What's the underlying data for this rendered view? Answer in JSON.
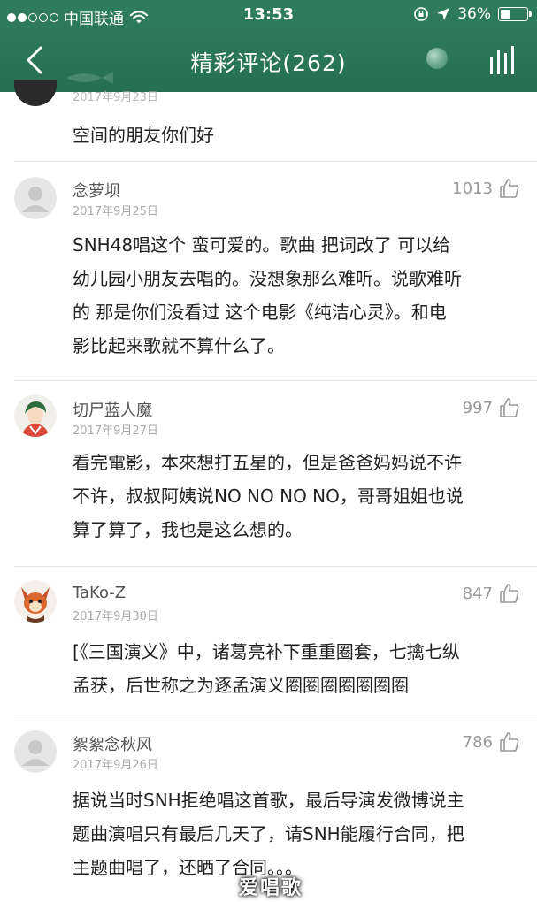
{
  "status_bar": {
    "carrier": "中国联通",
    "time": "13:53",
    "battery_percent": "36%",
    "battery_level": 0.36
  },
  "nav": {
    "title": "精彩评论(262)",
    "back_icon": "chevron-left-icon",
    "right_icon": "equalizer-bars-icon"
  },
  "partial_comment": {
    "date": "2017年9月23日",
    "text": "空间的朋友你们好"
  },
  "comments": [
    {
      "username": "念萝坝",
      "date": "2017年9月25日",
      "likes": "1013",
      "text": "SNH48唱这个 蛮可爱的。歌曲 把词改了 可以给幼儿园小朋友去唱的。没想象那么难听。说歌难听的 那是你们没看过 这个电影《纯洁心灵》。和电影比起来歌就不算什么了。",
      "lines": [
        "SNH48唱这个 蛮可爱的。歌曲 把词改了 可以给",
        "幼儿园小朋友去唱的。没想象那么难听。说歌难听",
        "的 那是你们没看过 这个电影《纯洁心灵》。和电",
        "影比起来歌就不算什么了。"
      ]
    },
    {
      "username": "切尸蓝人魔",
      "date": "2017年9月27日",
      "likes": "997",
      "lines": [
        "看完電影，本來想打五星的，但是爸爸妈妈说不许",
        "不许，叔叔阿姨说NO NO NO NO，哥哥姐姐也说",
        "算了算了，我也是这么想的。"
      ]
    },
    {
      "username": "TaKo-Z",
      "date": "2017年9月30日",
      "likes": "847",
      "lines": [
        "[《三国演义》中，诸葛亮补下重重圈套，七擒七纵",
        "孟获，后世称之为逐孟演义圈圈圈圈圈圈圈"
      ]
    },
    {
      "username": "絮絮念秋风",
      "date": "2017年9月26日",
      "likes": "786",
      "lines": [
        "据说当时SNH拒绝唱这首歌，最后导演发微博说主",
        "题曲演唱只有最后几天了，请SNH能履行合同，把",
        "主题曲唱了，还晒了合同。。。"
      ]
    }
  ],
  "watermark": "爱唱歌",
  "colors": {
    "header_bg": "#2a7656",
    "text": "#222222",
    "meta": "#aaaaaa"
  }
}
